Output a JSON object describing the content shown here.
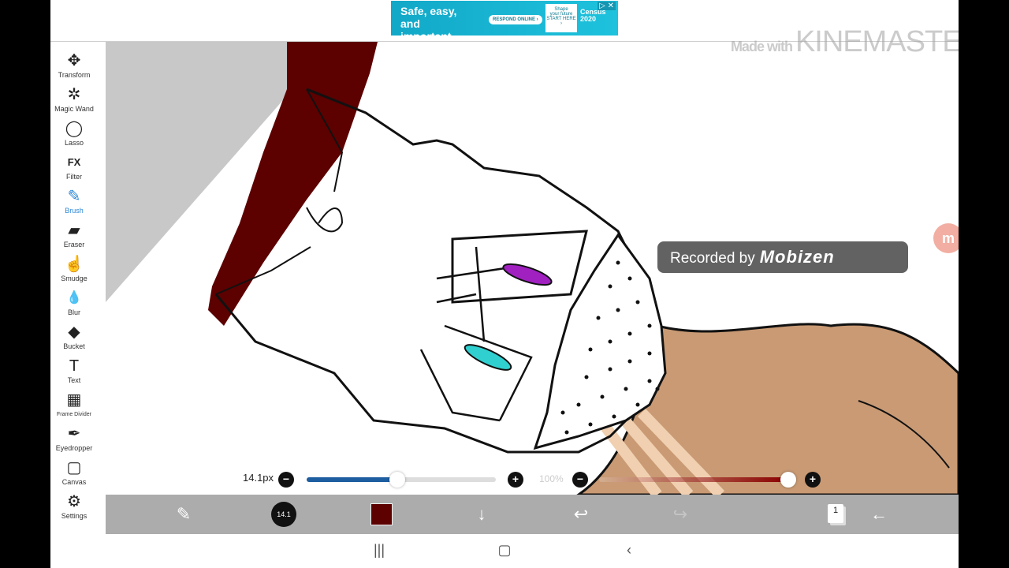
{
  "ad": {
    "headline": "Safe, easy,\nand important.",
    "cta": "RESPOND ONLINE ›",
    "mini_text": "Shape\nyour future\nSTART HERE ›",
    "brand": "Census\n2020",
    "close": "▷ ✕"
  },
  "watermarks": {
    "kinemaster_small": "Made with",
    "kinemaster": "KINEMASTER",
    "recorded_by": "Recorded by",
    "mobizen": "Mobizen",
    "mobizen_bubble": "m"
  },
  "toolbar": {
    "items": [
      {
        "label": "Transform",
        "icon": "✥"
      },
      {
        "label": "Magic Wand",
        "icon": "✲"
      },
      {
        "label": "Lasso",
        "icon": "◯"
      },
      {
        "label": "Filter",
        "icon": "FX"
      },
      {
        "label": "Brush",
        "icon": "✎"
      },
      {
        "label": "Eraser",
        "icon": "▰"
      },
      {
        "label": "Smudge",
        "icon": "☝"
      },
      {
        "label": "Blur",
        "icon": "💧"
      },
      {
        "label": "Bucket",
        "icon": "◆"
      },
      {
        "label": "Text",
        "icon": "T"
      },
      {
        "label": "Frame Divider",
        "icon": "▦"
      },
      {
        "label": "Eyedropper",
        "icon": "✒"
      },
      {
        "label": "Canvas",
        "icon": "▢"
      },
      {
        "label": "Settings",
        "icon": "⚙"
      }
    ],
    "active": "Brush"
  },
  "sliders": {
    "size_label": "14.1px",
    "size_value": 0.48,
    "opacity_label": "100%",
    "opacity_value": 1.0,
    "minus": "−",
    "plus": "+"
  },
  "bottom_bar": {
    "brush_size_label": "14.1",
    "color": "#5c0000",
    "layer_count": "1"
  },
  "colors": {
    "hair": "#5c0000",
    "skin": "#c99a74",
    "eye_purple": "#a020c0",
    "eye_cyan": "#30d0d0"
  }
}
